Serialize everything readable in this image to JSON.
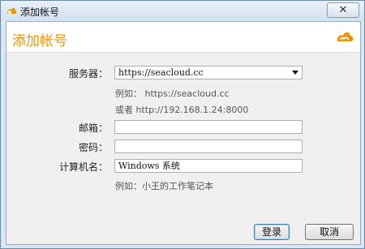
{
  "window": {
    "title": "添加帐号",
    "close_glyph": "✕"
  },
  "header": {
    "title": "添加帐号",
    "logo_icon": "seafile-cloud-logo",
    "accent_color": "#e8940c"
  },
  "form": {
    "server": {
      "label": "服务器：",
      "value": "https://seacloud.cc",
      "hint1": "例如： https://seacloud.cc",
      "hint2": "或者 http://192.168.1.24:8000"
    },
    "email": {
      "label": "邮箱：",
      "value": ""
    },
    "password": {
      "label": "密码：",
      "value": ""
    },
    "computer_name": {
      "label": "计算机名：",
      "value": "Windows 系统",
      "hint": "例如：小王的工作笔记本"
    }
  },
  "buttons": {
    "login": "登录",
    "cancel": "取消"
  }
}
